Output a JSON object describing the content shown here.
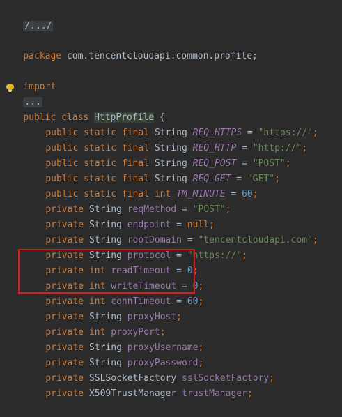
{
  "editor": {
    "lines": {
      "header_comment": "/.../",
      "package_kw": "package",
      "package_name": " com.tencentcloudapi.common.profile;",
      "import_kw": "import",
      "import_fold": "...",
      "class_public": "public",
      "class_kw": "class",
      "class_name": "HttpProfile",
      "class_open": " {",
      "mod_pub_static_final": "public static final",
      "mod_private": "private",
      "type_string": "String",
      "type_int": "int",
      "type_ssl": "SSLSocketFactory",
      "type_x509": "X509TrustManager",
      "req_https": "REQ_HTTPS",
      "req_https_val": "\"https://\"",
      "req_http": "REQ_HTTP",
      "req_http_val": "\"http://\"",
      "req_post": "REQ_POST",
      "req_post_val": "\"POST\"",
      "req_get": "REQ_GET",
      "req_get_val": "\"GET\"",
      "tm_minute": "TM_MINUTE",
      "tm_minute_val": "60",
      "req_method": "reqMethod",
      "req_method_val": "\"POST\"",
      "endpoint": "endpoint",
      "null_kw": "null",
      "root_domain": "rootDomain",
      "root_domain_val": "\"tencentcloudapi.com\"",
      "protocol": "protocol",
      "protocol_val": "\"https://\"",
      "read_timeout": "readTimeout",
      "read_timeout_val": "0",
      "write_timeout": "writeTimeout",
      "write_timeout_val": "0",
      "conn_timeout": "connTimeout",
      "conn_timeout_val": "60",
      "proxy_host": "proxyHost",
      "proxy_port": "proxyPort",
      "proxy_username": "proxyUsername",
      "proxy_password": "proxyPassword",
      "ssl_socket_factory": "sslSocketFactory",
      "trust_manager": "trustManager",
      "eq": " = ",
      "semi": ";"
    },
    "colors": {
      "background": "#2b2b2b",
      "keyword": "#cc7832",
      "string": "#6a8759",
      "number": "#6897bb",
      "field": "#9876aa",
      "text": "#a9b7c6",
      "highlight_border": "#e0161b",
      "bulb": "#e6b422"
    },
    "icons": {
      "intention_bulb": "lightbulb-icon"
    }
  }
}
